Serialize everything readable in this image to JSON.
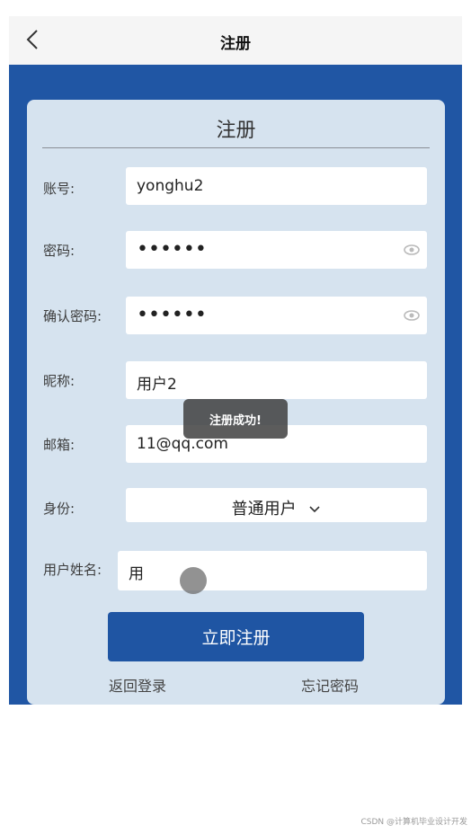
{
  "header": {
    "title": "注册"
  },
  "form": {
    "title": "注册",
    "fields": {
      "account": {
        "label": "账号:",
        "value": "yonghu2"
      },
      "password": {
        "label": "密码:",
        "value": "••••••"
      },
      "confirm_password": {
        "label": "确认密码:",
        "value": "••••••"
      },
      "nickname": {
        "label": "昵称:",
        "value": "用户2"
      },
      "email": {
        "label": "邮箱:",
        "value": "11@qq.com"
      },
      "role": {
        "label": "身份:",
        "value": "普通用户"
      },
      "username": {
        "label": "用户姓名:",
        "value": "用"
      }
    },
    "submit_label": "立即注册",
    "back_to_login": "返回登录",
    "forgot_password": "忘记密码"
  },
  "toast": {
    "text": "注册成功!"
  },
  "watermark": "CSDN @计算机毕业设计开发",
  "colors": {
    "primary": "#2056a4",
    "card": "#d6e3ef",
    "header_bg": "#f5f5f5"
  }
}
